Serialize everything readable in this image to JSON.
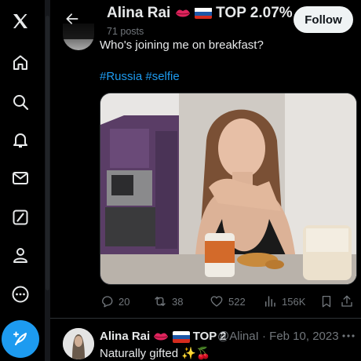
{
  "header": {
    "name": "Alina Rai",
    "badge": "TOP 2.07%",
    "posts": "71 posts",
    "follow_label": "Follow"
  },
  "nav": {
    "items": [
      "x-logo-icon",
      "home-icon",
      "search-icon",
      "notifications-icon",
      "messages-icon",
      "grok-icon",
      "profile-icon",
      "more-icon"
    ],
    "compose_icon": "compose-post-icon"
  },
  "tweet": {
    "text": "Who's joining me on breakfast?",
    "hashtags": "#Russia #selfie",
    "replies": "20",
    "reposts": "38",
    "likes": "522",
    "views": "156K"
  },
  "reply": {
    "name": "Alina Rai",
    "badge": "TOP 2",
    "handle": "@AlinaI",
    "date": "· Feb 10, 2023",
    "text": "Naturally gifted ✨🍒"
  },
  "colors": {
    "accent": "#1d9bf0",
    "background": "#000000",
    "text": "#e7e9ea",
    "muted": "#71767b"
  }
}
